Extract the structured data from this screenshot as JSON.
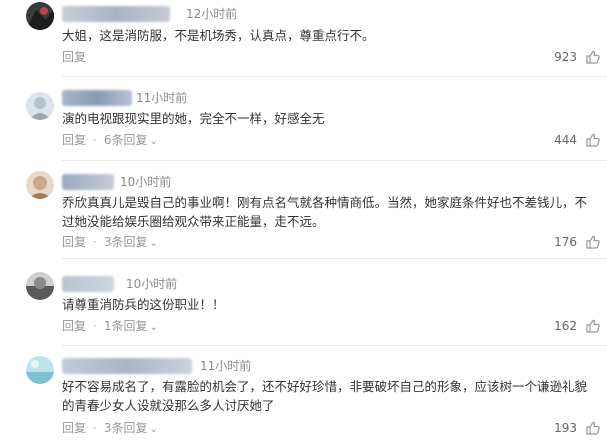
{
  "colors": {
    "text": "#333333",
    "meta": "#999999",
    "divider": "#e9e9e9"
  },
  "comments": [
    {
      "username": "大漠孤烟直长河落日圆",
      "time": "12小时前",
      "text_lines": [
        "大姐，这是消防服，不是机场秀，认真点，尊重点行不。"
      ],
      "reply_label": "回复",
      "replies": "",
      "likes": "923"
    },
    {
      "username": "梦醒的口罩",
      "time": "11小时前",
      "text_lines": [
        "演的电视跟现实里的她，完全不一样，好感全无"
      ],
      "reply_label": "回复",
      "replies": "6条回复",
      "likes": "444"
    },
    {
      "username": "京哥哥花",
      "time": "10小时前",
      "text_lines": [
        "乔欣真真儿是毁自己的事业啊！刚有点名气就各种情商低。当然，她家庭条件好也不差钱儿，不",
        "过她没能给娱乐圈给观众带来正能量，走不远。"
      ],
      "reply_label": "回复",
      "replies": "3条回复",
      "likes": "176"
    },
    {
      "username": "清晨的风晚",
      "time": "10小时前",
      "text_lines": [
        "请尊重消防兵的这份职业！！"
      ],
      "reply_label": "回复",
      "replies": "1条回复",
      "likes": "162"
    },
    {
      "username": "阳光明媚的小日子",
      "time": "11小时前",
      "text_lines": [
        "好不容易成名了，有露脸的机会了，还不好好珍惜，非要破坏自己的形象，应该树一个谦逊礼貌",
        "的青春少女人设就没那么多人讨厌她了"
      ],
      "reply_label": "回复",
      "replies": "3条回复",
      "likes": "193"
    }
  ]
}
